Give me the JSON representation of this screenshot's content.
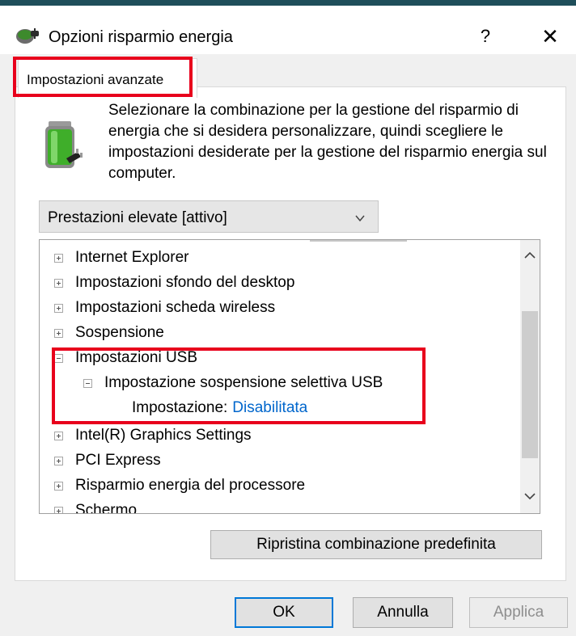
{
  "window": {
    "title": "Opzioni risparmio energia",
    "help_glyph": "?",
    "close_glyph": "✕"
  },
  "tab": {
    "label": "Impostazioni avanzate"
  },
  "description": "Selezionare la combinazione per la gestione del risparmio di energia che si desidera personalizzare, quindi scegliere le impostazioni desiderate per la gestione del risparmio energia sul computer.",
  "plan_select": {
    "value": "Prestazioni elevate [attivo]"
  },
  "tree": {
    "items": [
      {
        "label": "Internet Explorer"
      },
      {
        "label": "Impostazioni sfondo del desktop"
      },
      {
        "label": "Impostazioni scheda wireless"
      },
      {
        "label": "Sospensione"
      },
      {
        "label": "Impostazioni USB"
      },
      {
        "label": "Impostazione sospensione selettiva USB"
      },
      {
        "setting_label": "Impostazione:",
        "setting_value": "Disabilitata"
      },
      {
        "label": "Intel(R) Graphics Settings"
      },
      {
        "label": "PCI Express"
      },
      {
        "label": "Risparmio energia del processore"
      },
      {
        "label": "Schermo"
      }
    ]
  },
  "buttons": {
    "restore": "Ripristina combinazione predefinita",
    "ok": "OK",
    "cancel": "Annulla",
    "apply": "Applica"
  },
  "colors": {
    "highlight_box": "#e8001c",
    "link_value": "#0066cc",
    "title_band": "#1f4e5a",
    "ok_focus_border": "#0078d7"
  },
  "icons": {
    "app": "power-options-icon",
    "battery": "battery-plug-icon",
    "close": "close-icon",
    "help": "help-icon"
  }
}
